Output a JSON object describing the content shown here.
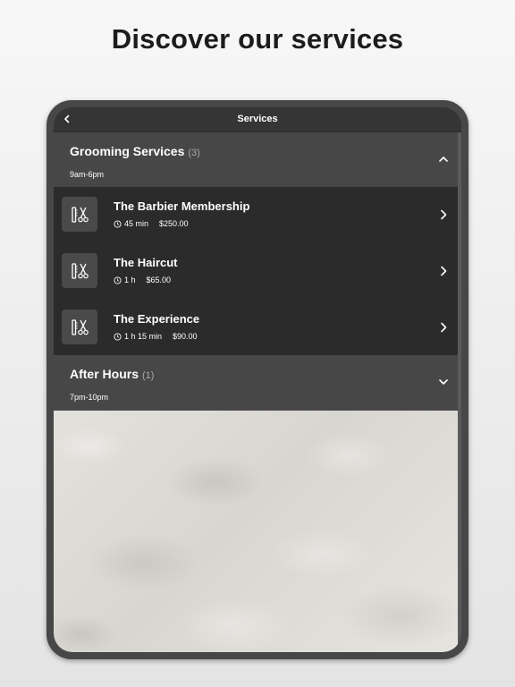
{
  "headline": "Discover our services",
  "navbar": {
    "title": "Services",
    "back_icon": "chevron-left-icon"
  },
  "sections": [
    {
      "title": "Grooming Services",
      "count": "(3)",
      "hours": "9am-6pm",
      "expanded": true,
      "toggle_icon": "chevron-up-icon",
      "services": [
        {
          "name": "The Barbier Membership",
          "duration": "45 min",
          "price": "$250.00",
          "icon": "comb-scissors-icon"
        },
        {
          "name": "The Haircut",
          "duration": "1 h",
          "price": "$65.00",
          "icon": "comb-scissors-icon"
        },
        {
          "name": "The Experience",
          "duration": "1 h 15 min",
          "price": "$90.00",
          "icon": "comb-scissors-icon"
        }
      ]
    },
    {
      "title": "After Hours",
      "count": "(1)",
      "hours": "7pm-10pm",
      "expanded": false,
      "toggle_icon": "chevron-down-icon"
    }
  ],
  "colors": {
    "device_frame": "#474747",
    "section_header": "#474747",
    "service_list": "#2b2b2b",
    "icon_tile": "#4a4a4a",
    "text": "#ffffff",
    "count_text": "#a9a9a9"
  }
}
